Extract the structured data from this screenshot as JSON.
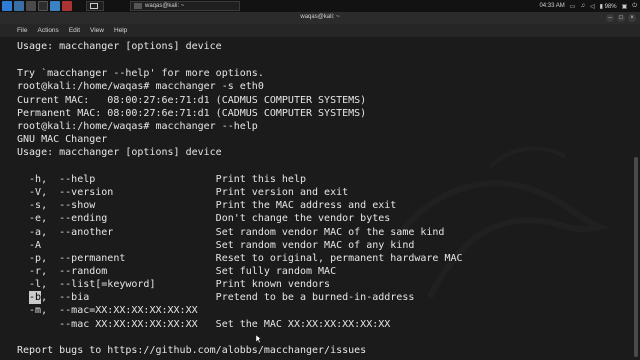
{
  "taskbar": {
    "window_title": "waqas@kali: ~",
    "clock": "04:33 AM",
    "battery": "98%"
  },
  "titlebar": {
    "title": "waqas@kali: ~"
  },
  "menu": [
    "File",
    "Actions",
    "Edit",
    "View",
    "Help"
  ],
  "terminal": {
    "lines": [
      "Usage: macchanger [options] device",
      "",
      "Try `macchanger --help' for more options.",
      "root@kali:/home/waqas# macchanger -s eth0",
      "Current MAC:   08:00:27:6e:71:d1 (CADMUS COMPUTER SYSTEMS)",
      "Permanent MAC: 08:00:27:6e:71:d1 (CADMUS COMPUTER SYSTEMS)",
      "root@kali:/home/waqas# macchanger --help",
      "GNU MAC Changer",
      "Usage: macchanger [options] device",
      "",
      "  -h,  --help                    Print this help",
      "  -V,  --version                 Print version and exit",
      "  -s,  --show                    Print the MAC address and exit",
      "  -e,  --ending                  Don't change the vendor bytes",
      "  -a,  --another                 Set random vendor MAC of the same kind",
      "  -A                             Set random vendor MAC of any kind",
      "  -p,  --permanent               Reset to original, permanent hardware MAC",
      "  -r,  --random                  Set fully random MAC",
      "  -l,  --list[=keyword]          Print known vendors",
      "  -b,  --bia                     Pretend to be a burned-in-address",
      "  -m,  --mac=XX:XX:XX:XX:XX:XX",
      "       --mac XX:XX:XX:XX:XX:XX   Set the MAC XX:XX:XX:XX:XX:XX",
      "",
      "Report bugs to https://github.com/alobbs/macchanger/issues"
    ]
  }
}
